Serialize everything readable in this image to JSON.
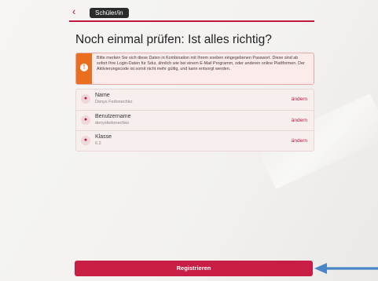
{
  "header": {
    "back_icon": "‹",
    "role_chip": "Schüler/in"
  },
  "page_title": "Noch einmal prüfen: Ist alles richtig?",
  "notice": {
    "icon": "!",
    "text": "Bitte merken Sie sich diese Daten in Kombination mit Ihrem soeben eingegebenen Passwort. Diese sind ab sofort Ihre Login-Daten für Sdui, ähnlich wie bei einem E-Mail Programm, oder anderen online Plattformen. Der Aktivierungscode ist somit nicht mehr gültig, und kann entsorgt werden."
  },
  "fields": [
    {
      "label": "Name",
      "value": "Denys Fedonechko",
      "action": "ändern"
    },
    {
      "label": "Benutzername",
      "value": "denysfedonechko",
      "action": "ändern"
    },
    {
      "label": "Klasse",
      "value": "6.2",
      "action": "ändern"
    }
  ],
  "submit_label": "Registrieren",
  "colors": {
    "accent": "#c81d44",
    "warning": "#e96f1f",
    "annotation_arrow": "#4a86c5"
  }
}
